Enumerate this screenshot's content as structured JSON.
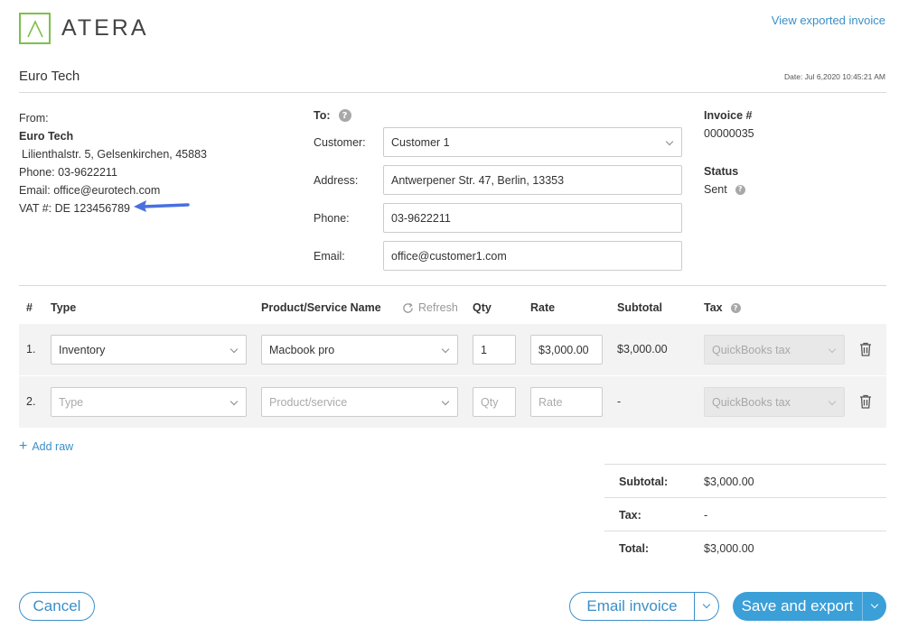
{
  "brand": {
    "name": "ATERA",
    "accent": "#7cc04b"
  },
  "header": {
    "view_link": "View exported invoice",
    "company": "Euro Tech",
    "date": "Date: Jul 6,2020 10:45:21 AM"
  },
  "from": {
    "label": "From:",
    "name": "Euro Tech",
    "address": "Lilienthalstr. 5, Gelsenkirchen, 45883",
    "phone": "Phone: 03-9622211",
    "email": "Email: office@eurotech.com",
    "vat": "VAT #: DE 123456789"
  },
  "to": {
    "label": "To:",
    "customer_label": "Customer:",
    "customer_value": "Customer 1",
    "address_label": "Address:",
    "address_value": "Antwerpener Str. 47, Berlin, 13353",
    "phone_label": "Phone:",
    "phone_value": "03-9622211",
    "email_label": "Email:",
    "email_value": "office@customer1.com"
  },
  "invoice": {
    "number_label": "Invoice #",
    "number": "00000035",
    "status_label": "Status",
    "status": "Sent"
  },
  "table": {
    "headers": {
      "num": "#",
      "type": "Type",
      "product": "Product/Service Name",
      "refresh": "Refresh",
      "qty": "Qty",
      "rate": "Rate",
      "subtotal": "Subtotal",
      "tax": "Tax"
    },
    "rows": [
      {
        "num": "1.",
        "type": "Inventory",
        "product": "Macbook pro",
        "qty": "1",
        "rate": "$3,000.00",
        "subtotal": "$3,000.00",
        "tax": "QuickBooks tax"
      },
      {
        "num": "2.",
        "type": "Type",
        "product": "Product/service",
        "qty": "Qty",
        "rate": "Rate",
        "subtotal": "-",
        "tax": "QuickBooks tax"
      }
    ]
  },
  "add_raw": "Add raw",
  "totals": {
    "subtotal_label": "Subtotal:",
    "subtotal": "$3,000.00",
    "tax_label": "Tax:",
    "tax": "-",
    "total_label": "Total:",
    "total": "$3,000.00"
  },
  "buttons": {
    "cancel": "Cancel",
    "email": "Email invoice",
    "save": "Save and export",
    "primary_color": "#3b9fd8"
  }
}
